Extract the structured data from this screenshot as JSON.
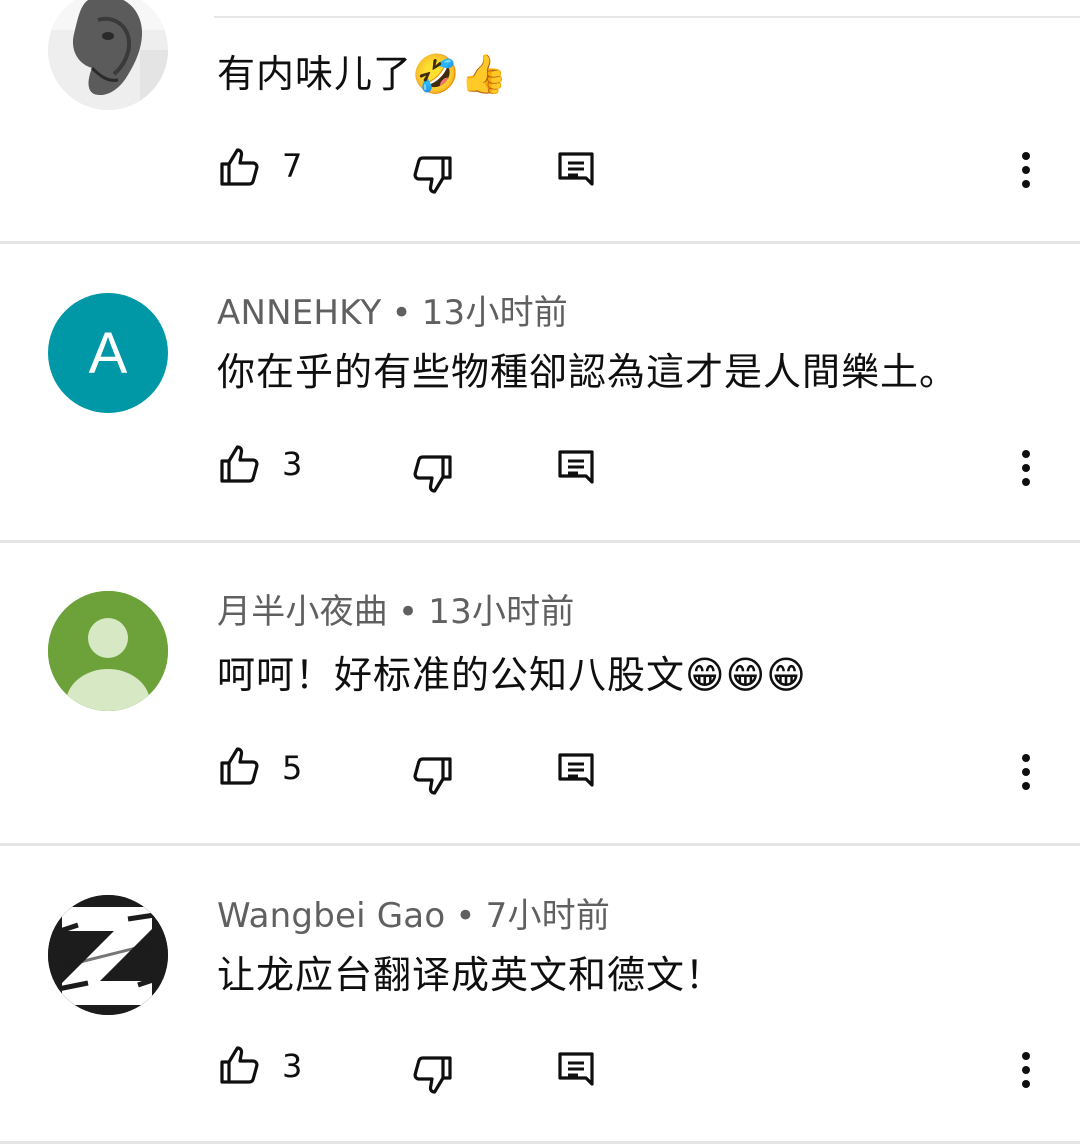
{
  "comments": [
    {
      "author": "",
      "time": "",
      "text": "有内味儿了🤣👍",
      "likes": "7",
      "avatar": {
        "type": "photo",
        "icon": "horse-statue-icon",
        "bg": "#f2f2f2"
      }
    },
    {
      "author": "ANNEHKY",
      "time": "13小时前",
      "text": "你在乎的有些物種卻認為這才是人間樂土。",
      "likes": "3",
      "avatar": {
        "type": "letter",
        "letter": "A",
        "bg": "#0097a7"
      }
    },
    {
      "author": "月半小夜曲",
      "time": "13小时前",
      "text": "呵呵！好标准的公知八股文😁😁😁",
      "likes": "5",
      "avatar": {
        "type": "default-person",
        "icon": "default-person-icon",
        "bg": "#6ca239"
      }
    },
    {
      "author": "Wangbei Gao",
      "time": "7小时前",
      "text": "让龙应台翻译成英文和德文！",
      "likes": "3",
      "avatar": {
        "type": "logo",
        "icon": "z-logo-icon",
        "bg": "#1c1c1c"
      }
    }
  ],
  "meta_separator": "•",
  "icons": {
    "like": "thumbs-up-icon",
    "dislike": "thumbs-down-icon",
    "reply": "reply-icon",
    "more": "more-vert-icon"
  }
}
